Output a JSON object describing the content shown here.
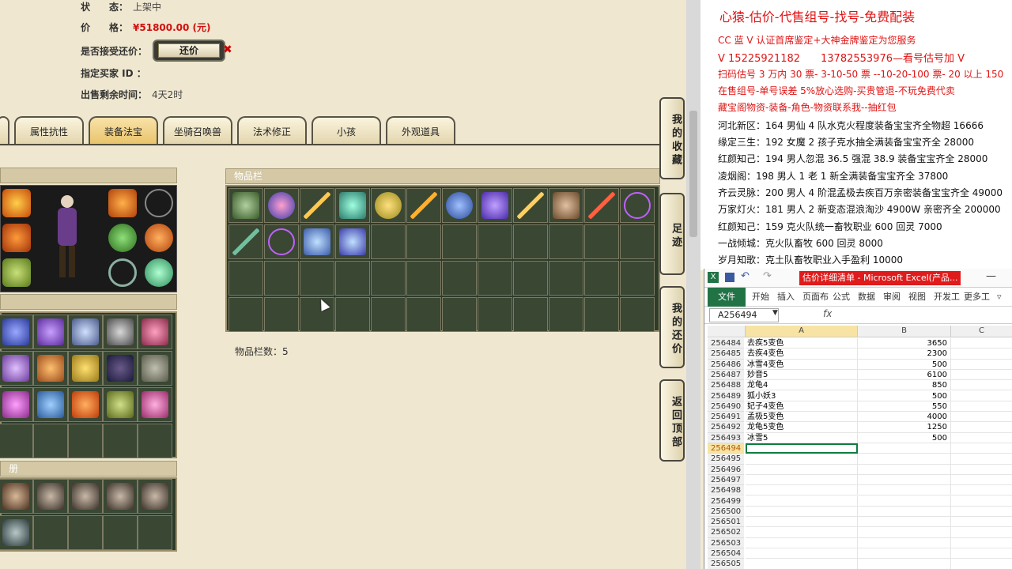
{
  "sale_info": {
    "status_label": "状　　态：",
    "status_value": "上架中",
    "price_label": "价　　格：",
    "price_value": "¥51800.00 (元)",
    "accept_offer_label": "是否接受还价：",
    "offer_button": "还价",
    "buyer_label": "指定买家 ID ：",
    "remaining_label": "出售剩余时间：",
    "remaining_value": "4天2时"
  },
  "tabs": [
    "属性抗性",
    "装备法宝",
    "坐骑召唤兽",
    "法术修正",
    "小孩",
    "外观道具"
  ],
  "active_tab": "装备法宝",
  "inventory": {
    "header": "物品栏",
    "count_label": "物品栏数：5"
  },
  "bottom_header": "册",
  "side_buttons": [
    "我的收藏",
    "足迹",
    "我的还价",
    "返回顶部"
  ],
  "ad": {
    "title": "心猿-估价-代售组号-找号-免费配装",
    "lines_red": [
      "CC 蓝 V 认证首席鉴定+大神金牌鉴定为您服务",
      "V 15225921182　　13782553976—看号估号加 V",
      "扫码估号 3 万内 30 票- 3-10-50 票 --10-20-100 票- 20 以上 150",
      "在售组号-单号误差 5%放心选购-买贵管退-不玩免费代卖",
      "藏宝阁物资-装备-角色-物资联系我--抽红包"
    ],
    "lines_black": [
      "河北新区：164 男仙 4 队水克火程度装备宝宝齐全物超 16666",
      "缘定三生：192 女魔 2 孩子克水抽全满装备宝宝齐全 28000",
      "红颜知己：194 男人忽混 36.5 强混 38.9 装备宝宝齐全 28000",
      "凌烟阁：198 男人 1 老 1 新全满装备宝宝齐全 37800",
      "齐云灵脉：200 男人 4 阶混孟极去疾百万亲密装备宝宝齐全 49000",
      "万家灯火：181 男人 2 新变态混浪淘沙 4900W 亲密齐全 200000",
      "红颜知己：159 克火队统一畜牧职业 600 回灵 7000",
      "一战倾城：克火队畜牧 600 回灵 8000",
      "岁月知歌：克土队畜牧职业入手盈利 10000"
    ]
  },
  "excel": {
    "caption": "估价详细清单 - Microsoft Excel(产品...",
    "ribbon_tabs": [
      "开始",
      "插入",
      "页面布",
      "公式",
      "数据",
      "审阅",
      "视图",
      "开发工",
      "更多工"
    ],
    "file_tab": "文件",
    "name_box": "A256494",
    "fx": "fx",
    "col_headers": [
      "A",
      "B",
      "C"
    ],
    "rows": [
      {
        "n": "256484",
        "a": "去疾5变色",
        "b": "3650"
      },
      {
        "n": "256485",
        "a": "去疾4变色",
        "b": "2300"
      },
      {
        "n": "256486",
        "a": "冰雪4变色",
        "b": "500"
      },
      {
        "n": "256487",
        "a": "妙音5",
        "b": "6100"
      },
      {
        "n": "256488",
        "a": "龙龟4",
        "b": "850"
      },
      {
        "n": "256489",
        "a": "狐小妖3",
        "b": "500"
      },
      {
        "n": "256490",
        "a": "妃子4变色",
        "b": "550"
      },
      {
        "n": "256491",
        "a": "孟极5变色",
        "b": "4000"
      },
      {
        "n": "256492",
        "a": "龙龟5变色",
        "b": "1250"
      },
      {
        "n": "256493",
        "a": "冰雪5",
        "b": "500"
      },
      {
        "n": "256494",
        "a": "",
        "b": ""
      },
      {
        "n": "256495",
        "a": "",
        "b": ""
      },
      {
        "n": "256496",
        "a": "",
        "b": ""
      },
      {
        "n": "256497",
        "a": "",
        "b": ""
      },
      {
        "n": "256498",
        "a": "",
        "b": ""
      },
      {
        "n": "256499",
        "a": "",
        "b": ""
      },
      {
        "n": "256500",
        "a": "",
        "b": ""
      },
      {
        "n": "256501",
        "a": "",
        "b": ""
      },
      {
        "n": "256502",
        "a": "",
        "b": ""
      },
      {
        "n": "256503",
        "a": "",
        "b": ""
      },
      {
        "n": "256504",
        "a": "",
        "b": ""
      },
      {
        "n": "256505",
        "a": "",
        "b": ""
      }
    ]
  },
  "colors": {
    "price_red": "#d01010",
    "ad_red": "#e01414",
    "excel_green": "#217346"
  }
}
